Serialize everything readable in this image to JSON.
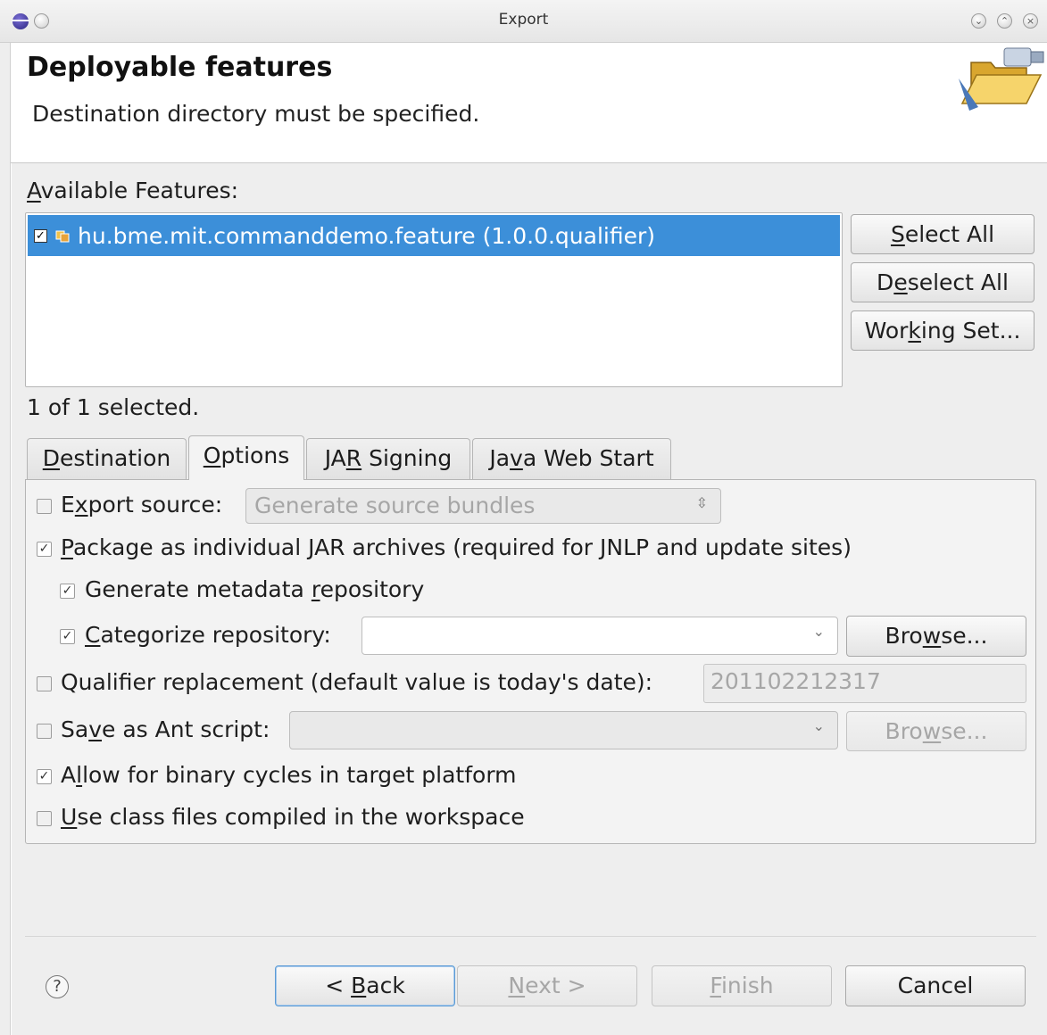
{
  "window": {
    "title": "Export"
  },
  "header": {
    "title": "Deployable features",
    "message": "Destination directory must be specified."
  },
  "features": {
    "label": "Available Features:",
    "items": [
      {
        "label": "hu.bme.mit.commanddemo.feature (1.0.0.qualifier)",
        "checked": true
      }
    ],
    "status": "1 of 1 selected.",
    "buttons": {
      "select_all": "Select All",
      "deselect_all": "Deselect All",
      "working_set": "Working Set..."
    }
  },
  "tabs": [
    "Destination",
    "Options",
    "JAR Signing",
    "Java Web Start"
  ],
  "active_tab": "Options",
  "options": {
    "export_source": {
      "label": "Export source:",
      "checked": false,
      "value": "Generate source bundles"
    },
    "package_jar": {
      "label": "Package as individual JAR archives (required for JNLP and update sites)",
      "checked": true
    },
    "generate_metadata": {
      "label": "Generate metadata repository",
      "checked": true
    },
    "categorize": {
      "label": "Categorize repository:",
      "checked": true,
      "value": "",
      "browse": "Browse..."
    },
    "qualifier": {
      "label": "Qualifier replacement (default value is today's date):",
      "checked": false,
      "value": "201102212317"
    },
    "ant_script": {
      "label": "Save as Ant script:",
      "checked": false,
      "value": "",
      "browse": "Browse..."
    },
    "binary_cycles": {
      "label": "Allow for binary cycles in target platform",
      "checked": true
    },
    "class_files": {
      "label": "Use class files compiled in the workspace",
      "checked": false
    }
  },
  "footer": {
    "help": "?",
    "back": "< Back",
    "next": "Next >",
    "finish": "Finish",
    "cancel": "Cancel"
  }
}
